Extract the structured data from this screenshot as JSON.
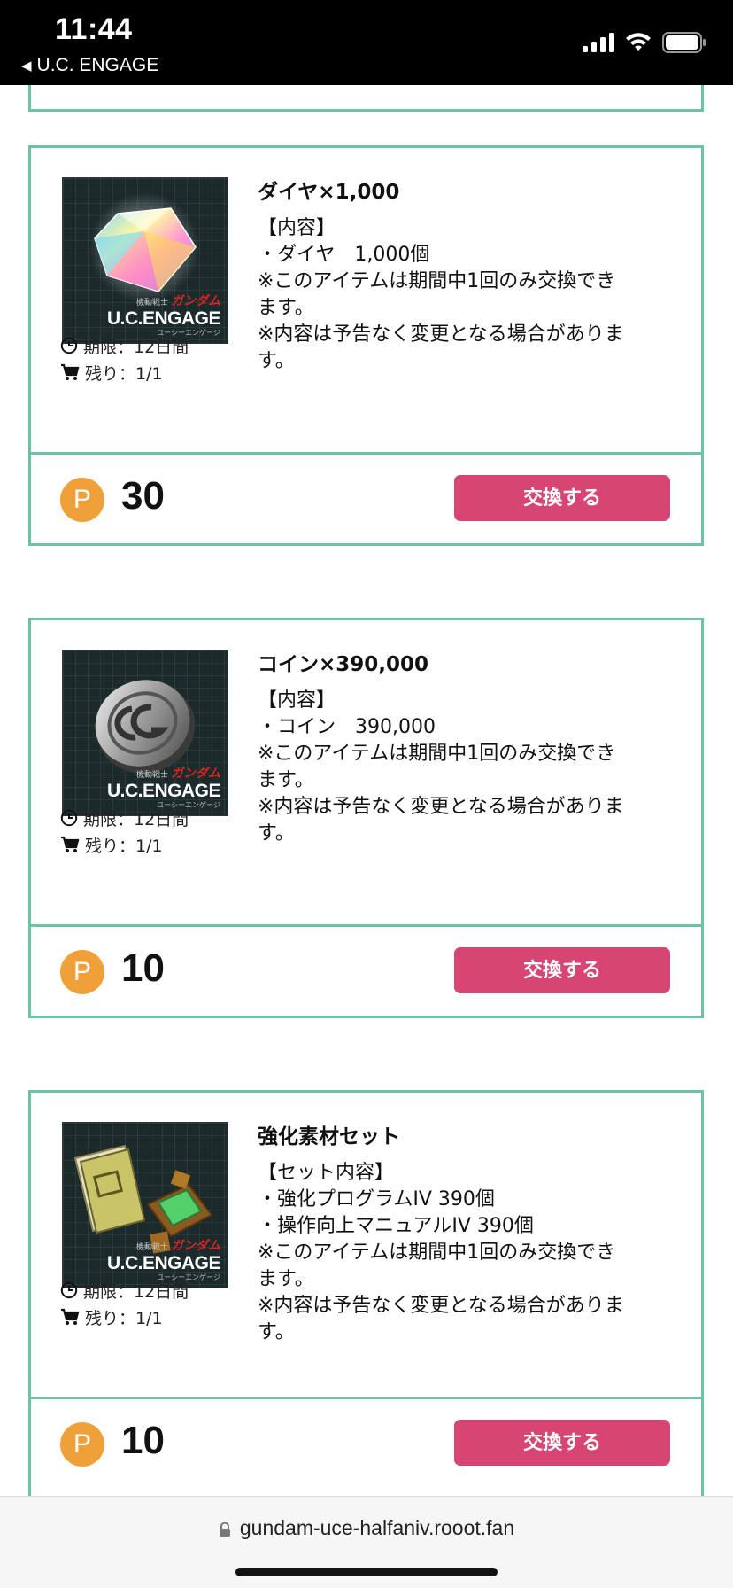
{
  "status_bar": {
    "time": "11:44",
    "back_label": "U.C. ENGAGE"
  },
  "brand": {
    "small": "機動戦士",
    "gundam": "ガンダム",
    "main": "U.C.ENGAGE",
    "sub": "ユーシーエンゲージ"
  },
  "meta_labels": {
    "deadline": "期限：12日間",
    "remaining": "残り：1/1"
  },
  "items": [
    {
      "title": "ダイヤ×1,000",
      "description": [
        "【内容】",
        "・ダイヤ　1,000個",
        "※このアイテムは期間中1回のみ交換でき",
        "ます。",
        "※内容は予告なく変更となる場合がありま",
        "す。"
      ],
      "deadline": "期限：12日間",
      "remaining": "残り：1/1",
      "points": "30",
      "point_symbol": "P",
      "button_label": "交換する",
      "image_icon": "diamond-icon"
    },
    {
      "title": "コイン×390,000",
      "description": [
        "【内容】",
        "・コイン　390,000",
        "※このアイテムは期間中1回のみ交換でき",
        "ます。",
        "※内容は予告なく変更となる場合がありま",
        "す。"
      ],
      "deadline": "期限：12日間",
      "remaining": "残り：1/1",
      "points": "10",
      "point_symbol": "P",
      "button_label": "交換する",
      "image_icon": "coin-icon"
    },
    {
      "title": "強化素材セット",
      "description": [
        "【セット内容】",
        "・強化プログラムIV 390個",
        "・操作向上マニュアルIV 390個",
        "※このアイテムは期間中1回のみ交換でき",
        "ます。",
        "※内容は予告なく変更となる場合がありま",
        "す。"
      ],
      "deadline": "期限：12日間",
      "remaining": "残り：1/1",
      "points": "10",
      "point_symbol": "P",
      "button_label": "交換する",
      "image_icon": "material-set-icon"
    }
  ],
  "url_bar": {
    "url": "gundam-uce-halfaniv.rooot.fan"
  },
  "colors": {
    "card_border": "#6cc3a3",
    "button": "#d74672",
    "point_badge": "#f0a038"
  }
}
